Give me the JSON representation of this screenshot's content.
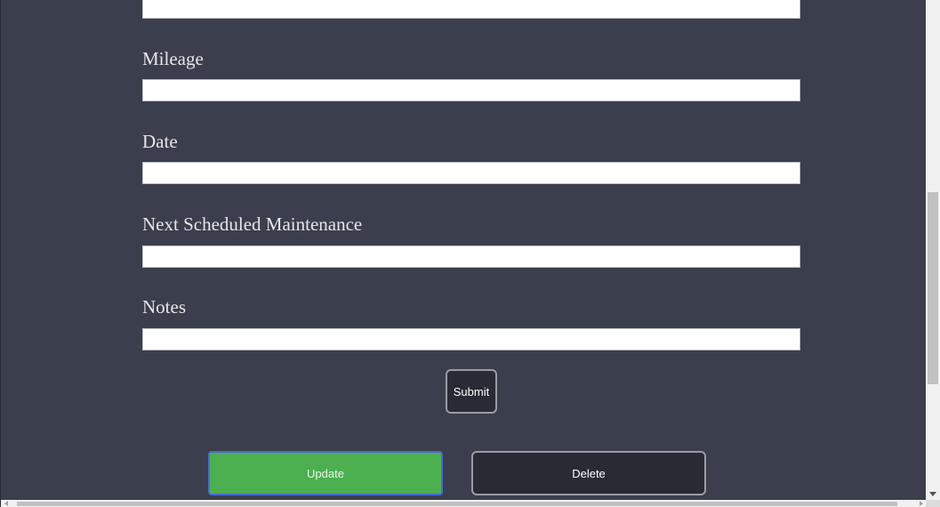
{
  "form": {
    "fields": [
      {
        "label": "",
        "value": ""
      },
      {
        "label": "Mileage",
        "value": ""
      },
      {
        "label": "Date",
        "value": ""
      },
      {
        "label": "Next Scheduled Maintenance",
        "value": ""
      },
      {
        "label": "Notes",
        "value": ""
      }
    ],
    "submit_label": "Submit"
  },
  "actions": {
    "update_label": "Update",
    "delete_label": "Delete"
  },
  "colors": {
    "background": "#3b3e4c",
    "update_button": "#4caf50",
    "dark_button": "#282a34"
  }
}
